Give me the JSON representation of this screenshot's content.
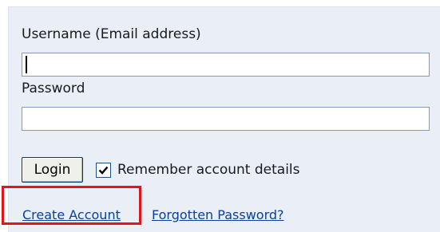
{
  "login_form": {
    "username_label": "Username (Email address)",
    "username_value": "",
    "password_label": "Password",
    "password_value": "",
    "login_button": "Login",
    "remember_label": "Remember account details",
    "remember_checked": true,
    "create_account_link": "Create Account",
    "forgotten_password_link": "Forgotten Password?",
    "highlight_color": "#e3151a"
  }
}
